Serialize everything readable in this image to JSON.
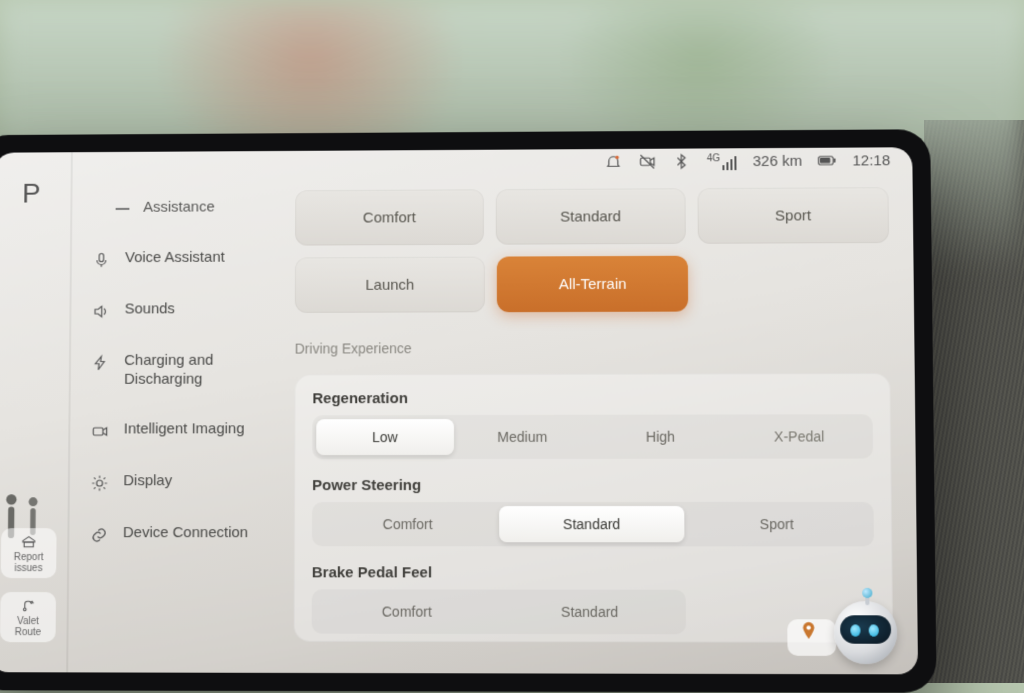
{
  "statusbar": {
    "network": "4G",
    "range": "326 km",
    "time": "12:18"
  },
  "rail": {
    "gear": "P",
    "report_label": "Report issues",
    "valet_label": "Valet Route"
  },
  "sidebar": {
    "items": [
      {
        "label": "Assistance"
      },
      {
        "label": "Voice Assistant"
      },
      {
        "label": "Sounds"
      },
      {
        "label": "Charging and Discharging"
      },
      {
        "label": "Intelligent Imaging"
      },
      {
        "label": "Display"
      },
      {
        "label": "Device Connection"
      }
    ]
  },
  "modes": {
    "comfort": "Comfort",
    "standard": "Standard",
    "sport": "Sport",
    "launch": "Launch",
    "all_terrain": "All-Terrain"
  },
  "section_title": "Driving Experience",
  "regen": {
    "title": "Regeneration",
    "low": "Low",
    "medium": "Medium",
    "high": "High",
    "xpedal": "X-Pedal"
  },
  "steering": {
    "title": "Power Steering",
    "comfort": "Comfort",
    "standard": "Standard",
    "sport": "Sport"
  },
  "brake": {
    "title": "Brake Pedal Feel",
    "comfort": "Comfort",
    "standard": "Standard"
  }
}
